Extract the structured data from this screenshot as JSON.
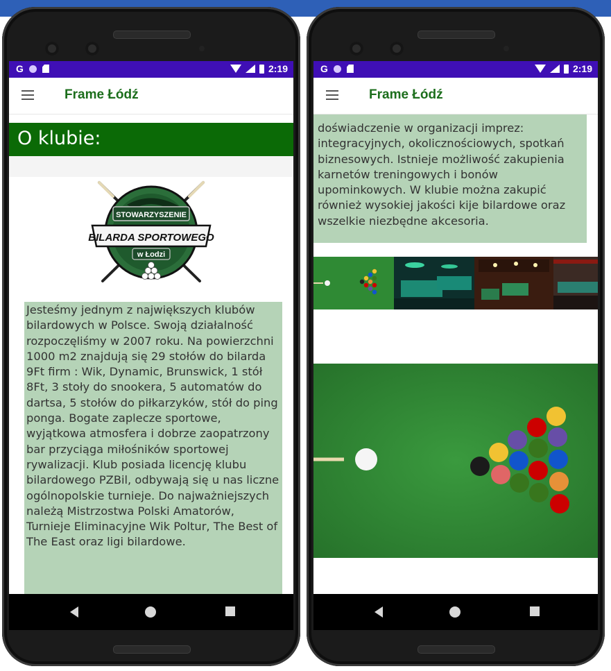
{
  "app": {
    "title": "Frame Łódź",
    "status_time": "2:19",
    "status_g": "G"
  },
  "left_screen": {
    "section_heading": "O klubie:",
    "logo": {
      "line1": "STOWARZYSZENIE",
      "line2": "BILARDA SPORTOWEGO",
      "line3": "w Łodzi"
    },
    "description": "Jesteśmy jednym z największych klubów bilardowych w Polsce. Swoją działalność rozpoczęliśmy w 2007 roku.  Na powierzchni 1000 m2 znajdują się 29 stołów do bilarda 9Ft firm : Wik, Dynamic, Brunswick, 1 stół 8Ft, 3 stoły do snookera, 5 automatów do dartsa, 5 stołów do piłkarzyków, stół do ping ponga. Bogate zaplecze sportowe, wyjątkowa atmosfera i dobrze zaopatrzony bar przyciąga miłośników sportowej rywalizacji.  Klub posiada licencję klubu bilardowego PZBil, odbywają się u nas liczne ogólnopolskie turnieje. Do najważniejszych należą Mistrzostwa Polski Amatorów, Turnieje Eliminacyjne Wik Poltur, The Best of The East oraz ligi bilardowe."
  },
  "right_screen": {
    "description": "doświadczenie w organizacji imprez: integracyjnych, okolicznościowych, spotkań biznesowych. Istnieje możliwość zakupienia karnetów treningowych i bonów upominkowych. W klubie można zakupić również wysokiej jakości kije bilardowe oraz wszelkie niezbędne akcesoria."
  },
  "colors": {
    "status_bar": "#3f0fb5",
    "section_header": "#0b6a06",
    "title_text": "#1c6e1c",
    "text_box": "#b5d3b7",
    "felt": "#2f8a34"
  },
  "icons": {
    "status_left": [
      "google-g-icon",
      "circle-notification-icon",
      "sd-card-icon"
    ],
    "status_right": [
      "wifi-icon",
      "signal-icon",
      "battery-icon"
    ],
    "navigation": [
      "back-icon",
      "home-icon",
      "recent-apps-icon"
    ],
    "menu": "hamburger-menu-icon"
  }
}
